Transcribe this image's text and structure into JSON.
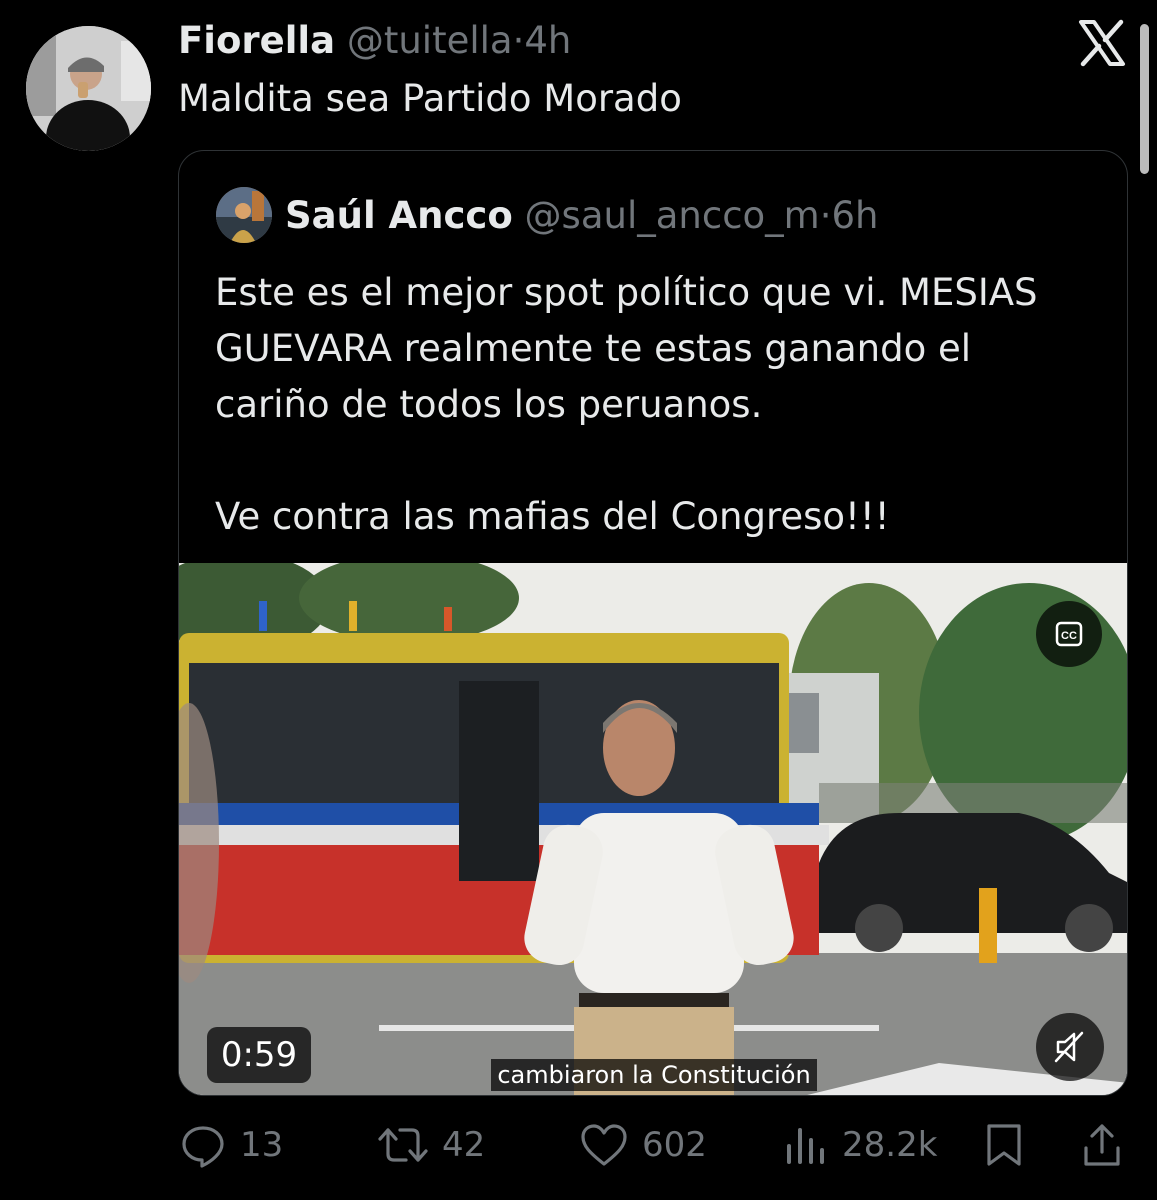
{
  "tweet": {
    "author": {
      "display_name": "Fiorella",
      "handle": "@tuitella"
    },
    "separator": "·",
    "time": "4h",
    "text": "Maldita sea Partido Morado"
  },
  "quoted_tweet": {
    "author": {
      "display_name": "Saúl Ancco",
      "handle": "@saul_ancco_m"
    },
    "separator": "·",
    "time": "6h",
    "paragraphs": [
      "Este es el mejor spot político que vi. MESIAS GUEVARA realmente te estas ganando el cariño de todos los peruanos.",
      "Ve contra las mafias del Congreso!!!"
    ],
    "video": {
      "duration": "0:59",
      "subtitle": "cambiaron la Constitución",
      "cc_icon": "closed-captions-icon",
      "mute_icon": "muted-speaker-icon"
    }
  },
  "actions": {
    "replies": "13",
    "reposts": "42",
    "likes": "602",
    "views": "28.2k"
  },
  "icons": {
    "close": "x-logo-icon",
    "reply": "reply-bubble-icon",
    "repost": "repost-arrows-icon",
    "like": "heart-icon",
    "views": "bar-chart-icon",
    "bookmark": "bookmark-icon",
    "share": "share-icon"
  },
  "colors": {
    "background": "#000000",
    "text": "#e7e9ea",
    "muted": "#71767b",
    "border": "#2f3336"
  }
}
